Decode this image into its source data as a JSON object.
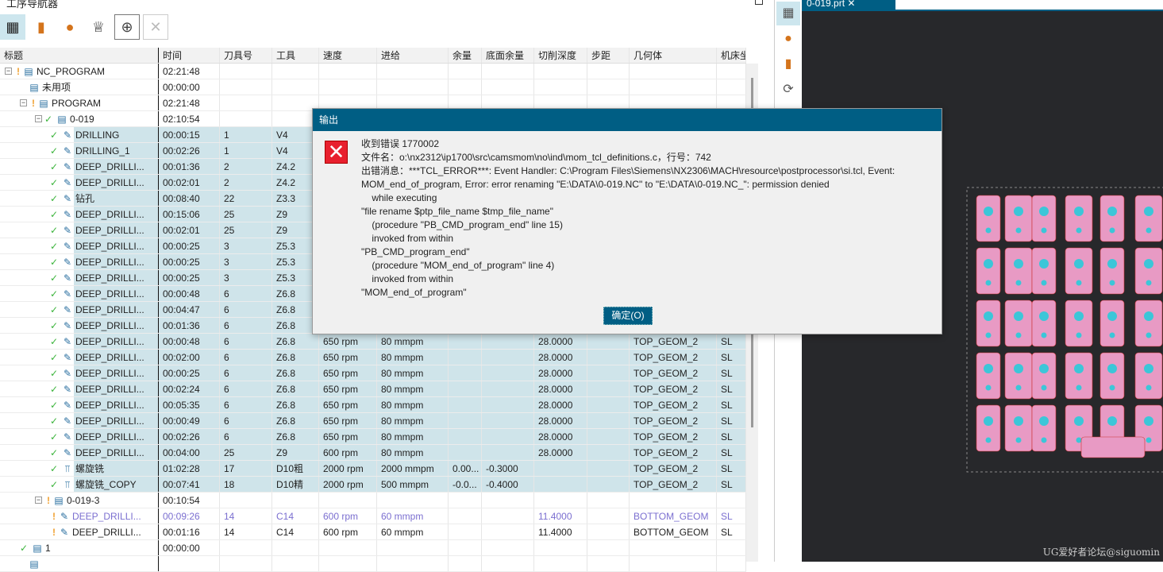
{
  "navigator": {
    "title": "工序导航器"
  },
  "columns": [
    "标题",
    "时间",
    "刀具号",
    "工具",
    "速度",
    "进给",
    "余量",
    "底面余量",
    "切削深度",
    "步距",
    "几何体",
    "机床坐标"
  ],
  "rows": [
    {
      "lvl": 0,
      "exp": true,
      "st": "warn",
      "ico": "program",
      "name": "NC_PROGRAM",
      "v": [
        "02:21:48",
        "",
        "",
        "",
        "",
        "",
        "",
        "",
        "",
        "",
        ""
      ]
    },
    {
      "lvl": 1,
      "st": "",
      "ico": "program",
      "name": "未用项",
      "v": [
        "00:00:00",
        "",
        "",
        "",
        "",
        "",
        "",
        "",
        "",
        "",
        ""
      ]
    },
    {
      "lvl": 1,
      "exp": true,
      "st": "warn",
      "ico": "program",
      "name": "PROGRAM",
      "v": [
        "02:21:48",
        "",
        "",
        "",
        "",
        "",
        "",
        "",
        "",
        "",
        ""
      ]
    },
    {
      "lvl": 2,
      "exp": true,
      "st": "check",
      "ico": "program",
      "name": "0-019",
      "v": [
        "02:10:54",
        "",
        "",
        "",
        "",
        "",
        "",
        "",
        "",
        "",
        ""
      ]
    },
    {
      "lvl": 3,
      "st": "check",
      "ico": "drill",
      "sel": true,
      "name": "DRILLING",
      "v": [
        "00:00:15",
        "1",
        "V4",
        "",
        "",
        "",
        "",
        "",
        "",
        "",
        ""
      ]
    },
    {
      "lvl": 3,
      "st": "check",
      "ico": "drill",
      "sel": true,
      "name": "DRILLING_1",
      "v": [
        "00:02:26",
        "1",
        "V4",
        "",
        "",
        "",
        "",
        "",
        "",
        "",
        ""
      ]
    },
    {
      "lvl": 3,
      "st": "check",
      "ico": "drill",
      "sel": true,
      "name": "DEEP_DRILLI...",
      "v": [
        "00:01:36",
        "2",
        "Z4.2",
        "",
        "",
        "",
        "",
        "",
        "",
        "",
        ""
      ]
    },
    {
      "lvl": 3,
      "st": "check",
      "ico": "drill",
      "sel": true,
      "name": "DEEP_DRILLI...",
      "v": [
        "00:02:01",
        "2",
        "Z4.2",
        "",
        "",
        "",
        "",
        "",
        "",
        "",
        ""
      ]
    },
    {
      "lvl": 3,
      "st": "check",
      "ico": "drill",
      "sel": true,
      "name": "钻孔",
      "v": [
        "00:08:40",
        "22",
        "Z3.3",
        "",
        "",
        "",
        "",
        "",
        "",
        "",
        ""
      ]
    },
    {
      "lvl": 3,
      "st": "check",
      "ico": "drill",
      "sel": true,
      "name": "DEEP_DRILLI...",
      "v": [
        "00:15:06",
        "25",
        "Z9",
        "",
        "",
        "",
        "",
        "",
        "",
        "",
        ""
      ]
    },
    {
      "lvl": 3,
      "st": "check",
      "ico": "drill",
      "sel": true,
      "name": "DEEP_DRILLI...",
      "v": [
        "00:02:01",
        "25",
        "Z9",
        "",
        "",
        "",
        "",
        "",
        "",
        "",
        ""
      ]
    },
    {
      "lvl": 3,
      "st": "check",
      "ico": "drill",
      "sel": true,
      "name": "DEEP_DRILLI...",
      "v": [
        "00:00:25",
        "3",
        "Z5.3",
        "",
        "",
        "",
        "",
        "",
        "",
        "",
        ""
      ]
    },
    {
      "lvl": 3,
      "st": "check",
      "ico": "drill",
      "sel": true,
      "name": "DEEP_DRILLI...",
      "v": [
        "00:00:25",
        "3",
        "Z5.3",
        "",
        "",
        "",
        "",
        "",
        "",
        "",
        ""
      ]
    },
    {
      "lvl": 3,
      "st": "check",
      "ico": "drill",
      "sel": true,
      "name": "DEEP_DRILLI...",
      "v": [
        "00:00:25",
        "3",
        "Z5.3",
        "",
        "",
        "",
        "",
        "",
        "",
        "",
        ""
      ]
    },
    {
      "lvl": 3,
      "st": "check",
      "ico": "drill",
      "sel": true,
      "name": "DEEP_DRILLI...",
      "v": [
        "00:00:48",
        "6",
        "Z6.8",
        "",
        "",
        "",
        "",
        "",
        "",
        "",
        ""
      ]
    },
    {
      "lvl": 3,
      "st": "check",
      "ico": "drill",
      "sel": true,
      "name": "DEEP_DRILLI...",
      "v": [
        "00:04:47",
        "6",
        "Z6.8",
        "",
        "",
        "",
        "",
        "",
        "",
        "",
        ""
      ]
    },
    {
      "lvl": 3,
      "st": "check",
      "ico": "drill",
      "sel": true,
      "name": "DEEP_DRILLI...",
      "v": [
        "00:01:36",
        "6",
        "Z6.8",
        "",
        "",
        "",
        "",
        "",
        "",
        "",
        ""
      ]
    },
    {
      "lvl": 3,
      "st": "check",
      "ico": "drill",
      "sel": true,
      "name": "DEEP_DRILLI...",
      "v": [
        "00:00:48",
        "6",
        "Z6.8",
        "650 rpm",
        "80 mmpm",
        "",
        "",
        "28.0000",
        "",
        "TOP_GEOM_2",
        "SL"
      ]
    },
    {
      "lvl": 3,
      "st": "check",
      "ico": "drill",
      "sel": true,
      "name": "DEEP_DRILLI...",
      "v": [
        "00:02:00",
        "6",
        "Z6.8",
        "650 rpm",
        "80 mmpm",
        "",
        "",
        "28.0000",
        "",
        "TOP_GEOM_2",
        "SL"
      ]
    },
    {
      "lvl": 3,
      "st": "check",
      "ico": "drill",
      "sel": true,
      "name": "DEEP_DRILLI...",
      "v": [
        "00:00:25",
        "6",
        "Z6.8",
        "650 rpm",
        "80 mmpm",
        "",
        "",
        "28.0000",
        "",
        "TOP_GEOM_2",
        "SL"
      ]
    },
    {
      "lvl": 3,
      "st": "check",
      "ico": "drill",
      "sel": true,
      "name": "DEEP_DRILLI...",
      "v": [
        "00:02:24",
        "6",
        "Z6.8",
        "650 rpm",
        "80 mmpm",
        "",
        "",
        "28.0000",
        "",
        "TOP_GEOM_2",
        "SL"
      ]
    },
    {
      "lvl": 3,
      "st": "check",
      "ico": "drill",
      "sel": true,
      "name": "DEEP_DRILLI...",
      "v": [
        "00:05:35",
        "6",
        "Z6.8",
        "650 rpm",
        "80 mmpm",
        "",
        "",
        "28.0000",
        "",
        "TOP_GEOM_2",
        "SL"
      ]
    },
    {
      "lvl": 3,
      "st": "check",
      "ico": "drill",
      "sel": true,
      "name": "DEEP_DRILLI...",
      "v": [
        "00:00:49",
        "6",
        "Z6.8",
        "650 rpm",
        "80 mmpm",
        "",
        "",
        "28.0000",
        "",
        "TOP_GEOM_2",
        "SL"
      ]
    },
    {
      "lvl": 3,
      "st": "check",
      "ico": "drill",
      "sel": true,
      "name": "DEEP_DRILLI...",
      "v": [
        "00:02:26",
        "6",
        "Z6.8",
        "650 rpm",
        "80 mmpm",
        "",
        "",
        "28.0000",
        "",
        "TOP_GEOM_2",
        "SL"
      ]
    },
    {
      "lvl": 3,
      "st": "check",
      "ico": "drill",
      "sel": true,
      "name": "DEEP_DRILLI...",
      "v": [
        "00:04:00",
        "25",
        "Z9",
        "600 rpm",
        "80 mmpm",
        "",
        "",
        "28.0000",
        "",
        "TOP_GEOM_2",
        "SL"
      ]
    },
    {
      "lvl": 3,
      "st": "check",
      "ico": "mill",
      "sel": true,
      "name": "螺旋铣",
      "v": [
        "01:02:28",
        "17",
        "D10粗",
        "2000 rpm",
        "2000 mmpm",
        "0.00...",
        "-0.3000",
        "",
        "",
        "TOP_GEOM_2",
        "SL"
      ]
    },
    {
      "lvl": 3,
      "st": "check",
      "ico": "mill",
      "sel": true,
      "name": "螺旋铣_COPY",
      "v": [
        "00:07:41",
        "18",
        "D10精",
        "2000 rpm",
        "500 mmpm",
        "-0.0...",
        "-0.4000",
        "",
        "",
        "TOP_GEOM_2",
        "SL"
      ]
    },
    {
      "lvl": 2,
      "exp": true,
      "st": "warn",
      "ico": "program",
      "name": "0-019-3",
      "v": [
        "00:10:54",
        "",
        "",
        "",
        "",
        "",
        "",
        "",
        "",
        "",
        ""
      ]
    },
    {
      "lvl": 3,
      "st": "warn",
      "ico": "drill",
      "alt": true,
      "name": "DEEP_DRILLI...",
      "v": [
        "00:09:26",
        "14",
        "C14",
        "600 rpm",
        "60 mmpm",
        "",
        "",
        "11.4000",
        "",
        "BOTTOM_GEOM",
        "SL"
      ]
    },
    {
      "lvl": 3,
      "st": "warn",
      "ico": "drill",
      "name": "DEEP_DRILLI...",
      "v": [
        "00:01:16",
        "14",
        "C14",
        "600 rpm",
        "60 mmpm",
        "",
        "",
        "11.4000",
        "",
        "BOTTOM_GEOM",
        "SL"
      ]
    },
    {
      "lvl": 1,
      "st": "check",
      "ico": "program",
      "name": "1",
      "v": [
        "00:00:00",
        "",
        "",
        "",
        "",
        "",
        "",
        "",
        "",
        "",
        ""
      ]
    },
    {
      "lvl": 1,
      "st": "",
      "ico": "program",
      "name": "",
      "v": [
        "",
        "",
        "",
        "",
        "",
        "",
        "",
        "",
        "",
        "",
        ""
      ]
    }
  ],
  "viewport": {
    "tab": "0-019.prt",
    "watermark": "UG爱好者论坛@siguomin"
  },
  "dialog": {
    "title": "输出",
    "ok": "确定(O)",
    "lines": [
      "收到错误 1770002",
      "文件名：o:\\nx2312\\ip1700\\src\\camsmom\\no\\ind\\mom_tcl_definitions.c，行号：742",
      "出错消息：***TCL_ERROR***: Event Handler: C:\\Program Files\\Siemens\\NX2306\\MACH\\resource\\postprocessor\\si.tcl, Event:",
      "MOM_end_of_program, Error: error renaming \"E:\\DATA\\0-019.NC\" to \"E:\\DATA\\0-019.NC_\": permission denied",
      "    while executing",
      "\"file rename $ptp_file_name $tmp_file_name\"",
      "    (procedure \"PB_CMD_program_end\" line 15)",
      "    invoked from within",
      "\"PB_CMD_program_end\"",
      "    (procedure \"MOM_end_of_program\" line 4)",
      "    invoked from within",
      "\"MOM_end_of_program\""
    ]
  }
}
